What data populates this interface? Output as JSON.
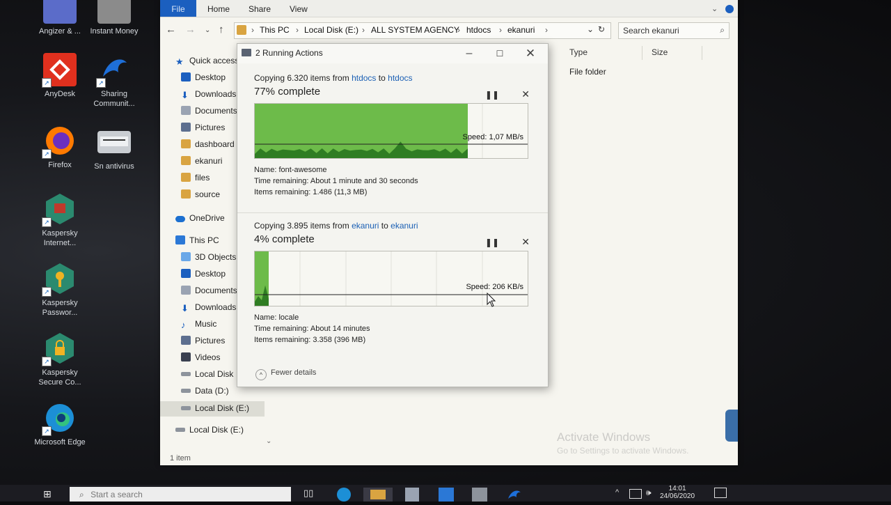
{
  "desktop": {
    "icons": [
      {
        "label": "Angizer & ...",
        "color": "#5b6cc9"
      },
      {
        "label": "Instant Money",
        "color": "#8b8b8b"
      },
      {
        "label": "AnyDesk",
        "color": "#e0301e"
      },
      {
        "label": "Sharing Communit...",
        "color": "#1e6fd9"
      },
      {
        "label": "Firefox",
        "color": "#ff7a00"
      },
      {
        "label": "Sn antivirus",
        "color": "#c9cdd2"
      },
      {
        "label": "Kaspersky Internet...",
        "color": "#2b8a6f"
      },
      {
        "label": "Kaspersky Passwor...",
        "color": "#2b8a6f"
      },
      {
        "label": "Kaspersky Secure Co...",
        "color": "#2b8a6f"
      },
      {
        "label": "Microsoft Edge",
        "color": "#1c8fd6"
      }
    ]
  },
  "explorer": {
    "ribbon": {
      "file": "File",
      "home": "Home",
      "share": "Share",
      "view": "View"
    },
    "address": {
      "crumbs": [
        "This PC",
        "Local Disk (E:)",
        "ALL SYSTEM AGENCY",
        "htdocs",
        "ekanuri"
      ]
    },
    "search": {
      "placeholder": "Search ekanuri"
    },
    "columns": {
      "type": "Type",
      "size": "Size"
    },
    "row": {
      "type": "File folder"
    },
    "nav": {
      "quick_access": "Quick access",
      "quick_items": [
        "Desktop",
        "Downloads",
        "Documents",
        "Pictures",
        "dashboard",
        "ekanuri",
        "files",
        "source"
      ],
      "onedrive": "OneDrive",
      "this_pc": "This PC",
      "pc_items": [
        "3D Objects",
        "Desktop",
        "Documents",
        "Downloads",
        "Music",
        "Pictures",
        "Videos",
        "Local Disk",
        "Data (D:)",
        "Local Disk (E:)"
      ],
      "extra": "Local Disk (E:)"
    },
    "status": "1 item",
    "watermark": {
      "line1": "Activate Windows",
      "line2": "Go to Settings to activate Windows."
    }
  },
  "dialog": {
    "title": "2 Running Actions",
    "ops": [
      {
        "head_prefix": "Copying 6.320 items from",
        "from": "htdocs",
        "to_word": "to",
        "to": "htdocs",
        "percent_text": "77% complete",
        "progress": 0.78,
        "speed": "Speed: 1,07 MB/s",
        "name": "Name:  font-awesome",
        "time": "Time remaining:  About 1 minute and 30 seconds",
        "items": "Items remaining:  1.486 (11,3 MB)"
      },
      {
        "head_prefix": "Copying 3.895 items from",
        "from": "ekanuri",
        "to_word": "to",
        "to": "ekanuri",
        "percent_text": "4% complete",
        "progress": 0.05,
        "speed": "Speed: 206 KB/s",
        "name": "Name:  locale",
        "time": "Time remaining:  About 14 minutes",
        "items": "Items remaining:  3.358 (396 MB)"
      }
    ],
    "fewer_details": "Fewer details"
  },
  "taskbar": {
    "search_placeholder": "Start a search",
    "time": "14:01",
    "date": "24/06/2020"
  }
}
